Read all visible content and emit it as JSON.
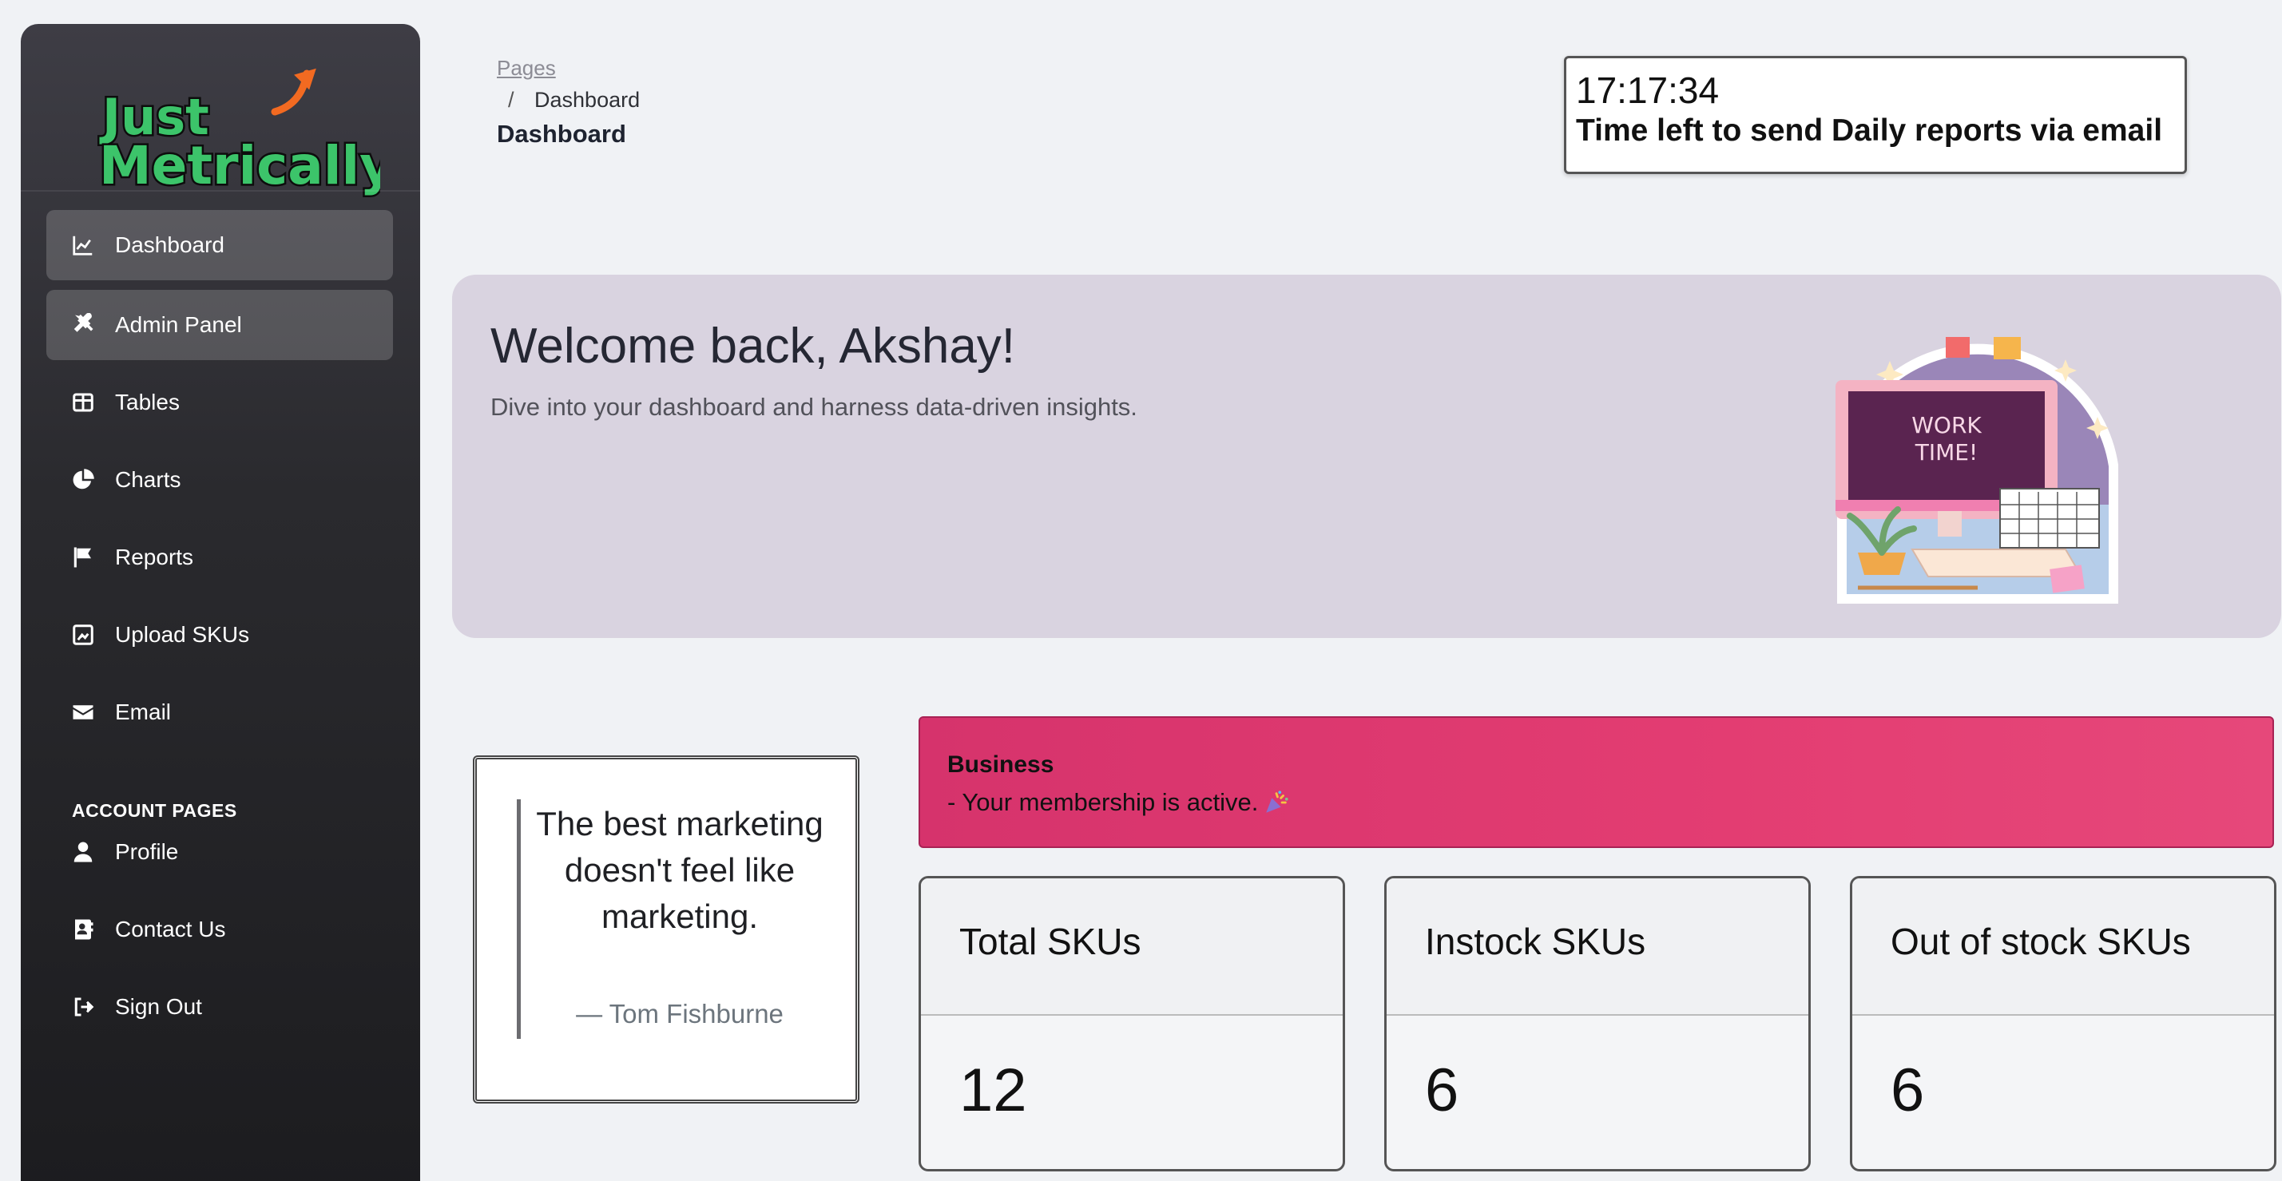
{
  "brand": {
    "line1": "Just",
    "line2": "Metrically"
  },
  "sidebar": {
    "items": [
      {
        "label": "Dashboard",
        "icon": "chart-line-icon",
        "active": true
      },
      {
        "label": "Admin Panel",
        "icon": "tools-icon",
        "active": true
      },
      {
        "label": "Tables",
        "icon": "table-icon",
        "active": false
      },
      {
        "label": "Charts",
        "icon": "pie-chart-icon",
        "active": false
      },
      {
        "label": "Reports",
        "icon": "flag-icon",
        "active": false
      },
      {
        "label": "Upload SKUs",
        "icon": "image-upload-icon",
        "active": false
      },
      {
        "label": "Email",
        "icon": "envelope-icon",
        "active": false
      }
    ],
    "account_section_title": "ACCOUNT PAGES",
    "account_items": [
      {
        "label": "Profile",
        "icon": "user-icon"
      },
      {
        "label": "Contact Us",
        "icon": "contact-card-icon"
      },
      {
        "label": "Sign Out",
        "icon": "sign-out-icon"
      }
    ]
  },
  "header": {
    "breadcrumb_root": "Pages",
    "breadcrumb_separator": "/",
    "breadcrumb_current": "Dashboard",
    "page_title": "Dashboard"
  },
  "timer": {
    "time": "17:17:34",
    "label": "Time left to send Daily reports via email"
  },
  "welcome": {
    "title": "Welcome back, Akshay!",
    "subtitle": "Dive into your dashboard and harness data-driven insights.",
    "illustration_text_1": "WORK",
    "illustration_text_2": "TIME!"
  },
  "quote": {
    "text": "The best marketing doesn't feel like marketing.",
    "author": "— Tom Fishburne"
  },
  "membership": {
    "title": "Business",
    "message": "- Your membership is active."
  },
  "stats": [
    {
      "label": "Total SKUs",
      "value": "12"
    },
    {
      "label": "Instock SKUs",
      "value": "6"
    },
    {
      "label": "Out of stock SKUs",
      "value": "6"
    }
  ],
  "colors": {
    "sidebar_bg": "#2a2a2e",
    "accent_pink": "#e33d72",
    "brand_green": "#3cc46a",
    "brand_orange": "#f26a21",
    "welcome_bg": "#d9d3e0"
  }
}
